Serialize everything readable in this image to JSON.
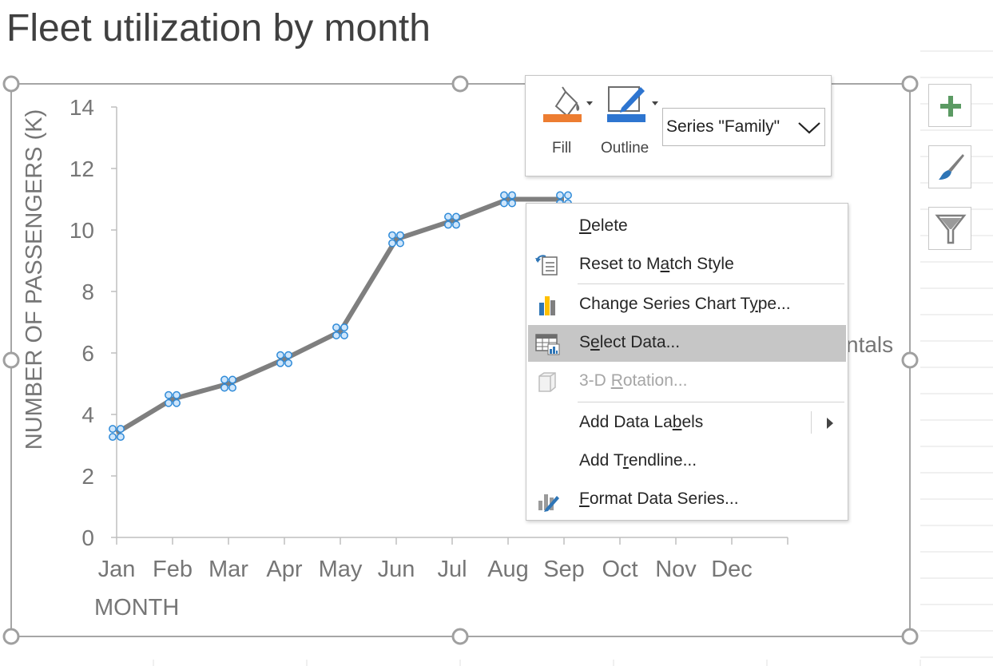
{
  "page": {
    "title": "Fleet utilization by month"
  },
  "chart_data": {
    "type": "line",
    "title": "Fleet utilization by month",
    "xlabel": "MONTH",
    "ylabel": "NUMBER OF PASSENGERS (K)",
    "categories": [
      "Jan",
      "Feb",
      "Mar",
      "Apr",
      "May",
      "Jun",
      "Jul",
      "Aug",
      "Sep",
      "Oct",
      "Nov",
      "Dec"
    ],
    "ylim": [
      0,
      14
    ],
    "yticks": [
      "0",
      "2",
      "4",
      "6",
      "8",
      "10",
      "12",
      "14"
    ],
    "series": [
      {
        "name": "Family",
        "values": [
          3.4,
          4.5,
          5.0,
          5.8,
          6.7,
          9.7,
          10.3,
          11.0,
          11.0
        ],
        "color": "#7f7f7f"
      }
    ],
    "partial_legend_text": "ntals",
    "grid": false
  },
  "mini_toolbar": {
    "fill_label": "Fill",
    "outline_label": "Outline",
    "series_selector": "Series \"Family\"",
    "fill_color": "#ed7d31",
    "outline_color": "#2e75d0"
  },
  "side_buttons": [
    {
      "icon": "plus-icon",
      "color": "#5b9a63"
    },
    {
      "icon": "paintbrush-icon",
      "color": "#2e75b6"
    },
    {
      "icon": "funnel-icon",
      "color": "#7f7f7f"
    }
  ],
  "context_menu": {
    "items": [
      {
        "pre": "",
        "key": "D",
        "post": "elete",
        "icon": ""
      },
      {
        "pre": "Reset to M",
        "key": "a",
        "post": "tch Style",
        "icon": "reset-style-icon"
      },
      {
        "pre": "Change Series Chart T",
        "key": "y",
        "post": "pe...",
        "icon": "bar-chart-icon"
      },
      {
        "pre": "S",
        "key": "e",
        "post": "lect Data...",
        "icon": "table-data-icon"
      },
      {
        "pre": "3-D ",
        "key": "R",
        "post": "otation...",
        "icon": "cube-icon"
      },
      {
        "pre": "Add Data La",
        "key": "b",
        "post": "els",
        "icon": ""
      },
      {
        "pre": "Add T",
        "key": "r",
        "post": "endline...",
        "icon": ""
      },
      {
        "pre": "",
        "key": "F",
        "post": "ormat Data Series...",
        "icon": "format-series-icon"
      }
    ],
    "highlighted": "Select Data...",
    "disabled": "3-D Rotation..."
  }
}
